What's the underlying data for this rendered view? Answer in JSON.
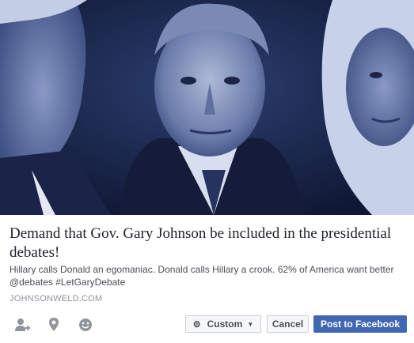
{
  "preview": {
    "title": "Demand that Gov. Gary Johnson be included in the presidential debates!",
    "description": "Hillary calls Donald an egomaniac. Donald calls Hillary a crook. 62% of America want better @debates #LetGaryDebate",
    "domain": "JOHNSONWELD.COM"
  },
  "toolbar": {
    "icons": [
      "tag-friends-icon",
      "location-icon",
      "feeling-icon"
    ],
    "privacy_label": "Custom",
    "cancel_label": "Cancel",
    "post_label": "Post to Facebook"
  },
  "colors": {
    "image_tint": "#3a4f85",
    "post_button": "#4267b2"
  }
}
